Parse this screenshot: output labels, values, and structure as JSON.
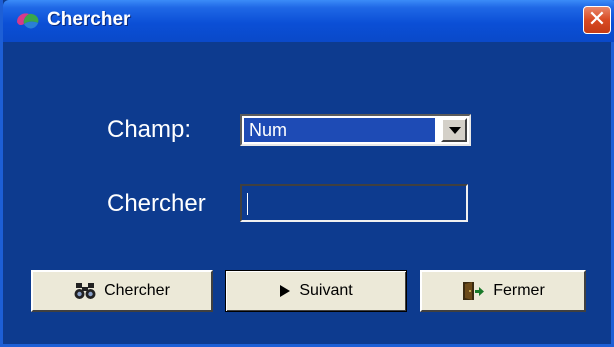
{
  "window": {
    "title": "Chercher",
    "close_glyph": "✕"
  },
  "form": {
    "champ_label": "Champ:",
    "champ_value": "Num",
    "chercher_label": "Chercher",
    "chercher_value": ""
  },
  "buttons": {
    "search": {
      "label": "Chercher",
      "icon": "binoculars-icon"
    },
    "next": {
      "label": "Suivant",
      "icon": "play-arrow-icon"
    },
    "close": {
      "label": "Fermer",
      "icon": "exit-door-icon"
    }
  },
  "colors": {
    "background": "#0d3b8f",
    "titlebar": "#0a49c9",
    "button_face": "#ece9d8",
    "selected": "#1e4bb5",
    "close_red": "#d94a22"
  }
}
